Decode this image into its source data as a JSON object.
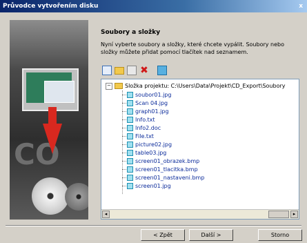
{
  "window": {
    "title": "Průvodce vytvořením disku",
    "close_label": "x"
  },
  "page": {
    "heading": "Soubory a složky",
    "description": "Nyní vyberte soubory a složky, které chcete vypálit. Soubory nebo složky můžete přidat pomocí tlačítek nad seznamem."
  },
  "tree": {
    "root_expander": "−",
    "root_label": "Složka projektu: C:\\Users\\Data\\Projekt\\CD_Export\\Soubory",
    "items": [
      "soubor01.jpg",
      "Scan 04.jpg",
      "graph01.jpg",
      "Info.txt",
      "Info2.doc",
      "File.txt",
      "picture02.jpg",
      "table03.jpg",
      "screen01_obrazek.bmp",
      "screen01_tlacitka.bmp",
      "screen01_nastaveni.bmp",
      "screen01.jpg"
    ],
    "scroll_left": "◂",
    "scroll_right": "▸"
  },
  "buttons": {
    "back": "< Zpět",
    "next": "Další >",
    "cancel": "Storno"
  }
}
